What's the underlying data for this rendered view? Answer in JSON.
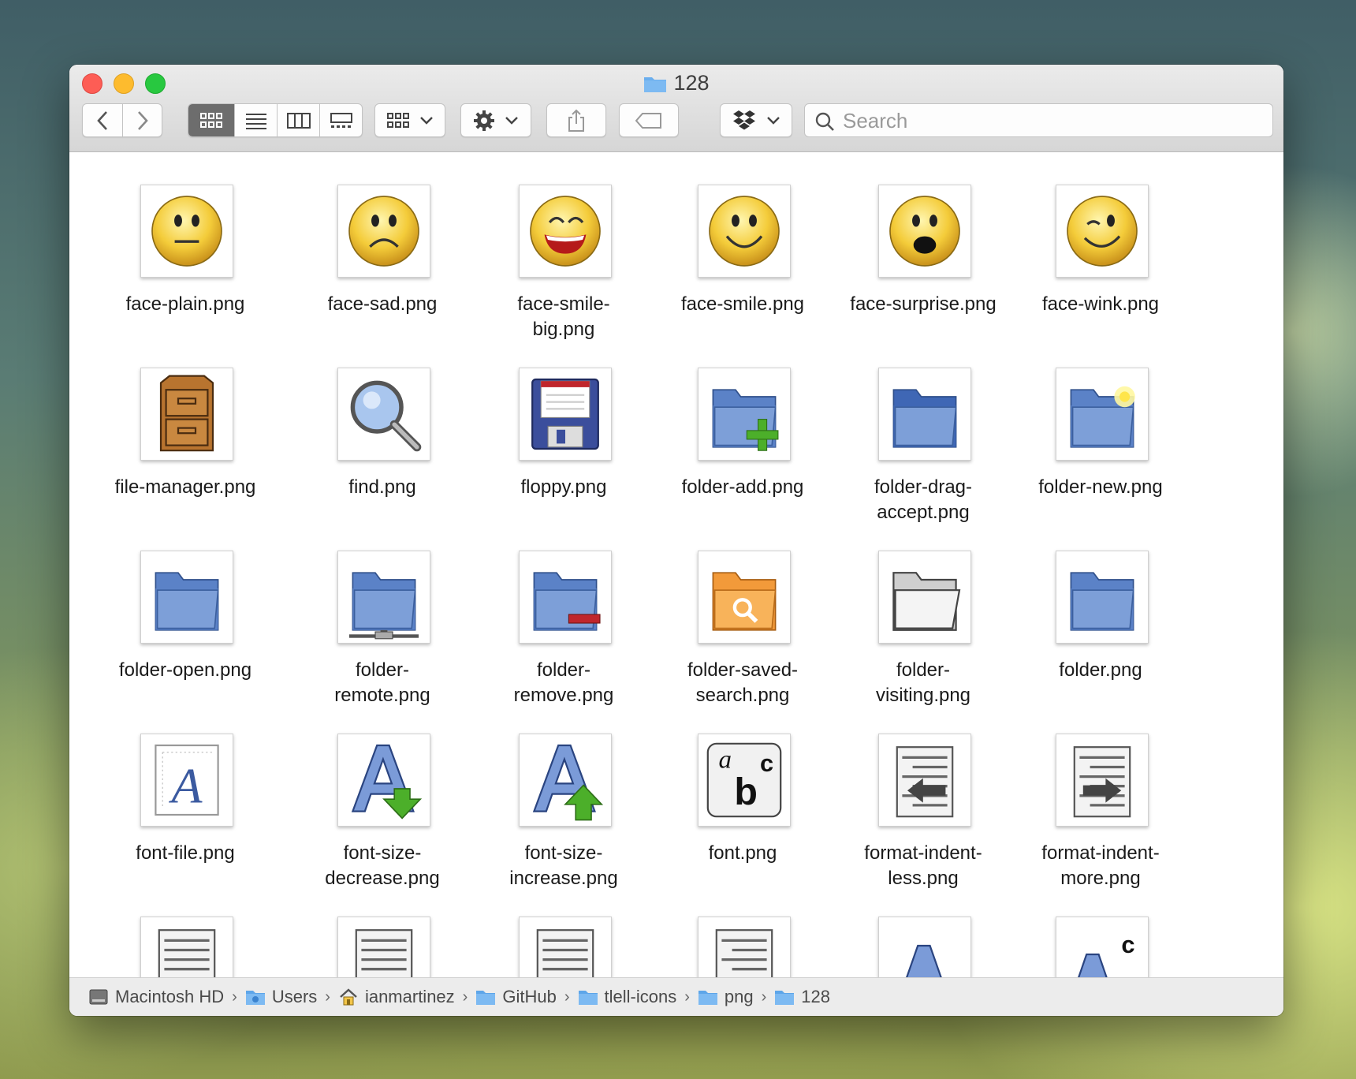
{
  "window": {
    "title": "128"
  },
  "toolbar": {
    "back_label": "back",
    "forward_label": "forward",
    "views": [
      "icon",
      "list",
      "column",
      "gallery"
    ],
    "arrange_label": "group",
    "action_label": "action",
    "share_label": "share",
    "tag_label": "tags",
    "dropbox_label": "dropbox"
  },
  "search": {
    "placeholder": "Search",
    "value": ""
  },
  "files": [
    {
      "name": "face-plain.png",
      "icon": "face-plain-icon"
    },
    {
      "name": "face-sad.png",
      "icon": "face-sad-icon"
    },
    {
      "name": "face-smile-big.png",
      "icon": "face-smile-big-icon"
    },
    {
      "name": "face-smile.png",
      "icon": "face-smile-icon"
    },
    {
      "name": "face-surprise.png",
      "icon": "face-surprise-icon"
    },
    {
      "name": "face-wink.png",
      "icon": "face-wink-icon"
    },
    {
      "name": "file-manager.png",
      "icon": "file-cabinet-icon"
    },
    {
      "name": "find.png",
      "icon": "magnifier-icon"
    },
    {
      "name": "floppy.png",
      "icon": "floppy-disk-icon"
    },
    {
      "name": "folder-add.png",
      "icon": "folder-add-icon"
    },
    {
      "name": "folder-drag-accept.png",
      "icon": "folder-drag-accept-icon"
    },
    {
      "name": "folder-new.png",
      "icon": "folder-new-icon"
    },
    {
      "name": "folder-open.png",
      "icon": "folder-open-icon"
    },
    {
      "name": "folder-remote.png",
      "icon": "folder-remote-icon"
    },
    {
      "name": "folder-remove.png",
      "icon": "folder-remove-icon"
    },
    {
      "name": "folder-saved-search.png",
      "icon": "folder-saved-search-icon"
    },
    {
      "name": "folder-visiting.png",
      "icon": "folder-visiting-icon"
    },
    {
      "name": "folder.png",
      "icon": "folder-icon"
    },
    {
      "name": "font-file.png",
      "icon": "font-file-icon"
    },
    {
      "name": "font-size-decrease.png",
      "icon": "font-size-decrease-icon"
    },
    {
      "name": "font-size-increase.png",
      "icon": "font-size-increase-icon"
    },
    {
      "name": "font.png",
      "icon": "font-icon"
    },
    {
      "name": "format-indent-less.png",
      "icon": "indent-less-icon"
    },
    {
      "name": "format-indent-more.png",
      "icon": "indent-more-icon"
    }
  ],
  "labels": [
    [
      "face-plain.png"
    ],
    [
      "face-sad.png"
    ],
    [
      "face-smile-",
      "big.png"
    ],
    [
      "face-smile.png"
    ],
    [
      "face-surprise.png"
    ],
    [
      "face-wink.png"
    ],
    [
      "file-manager.png"
    ],
    [
      "find.png"
    ],
    [
      "floppy.png"
    ],
    [
      "folder-add.png"
    ],
    [
      "folder-drag-",
      "accept.png"
    ],
    [
      "folder-new.png"
    ],
    [
      "folder-open.png"
    ],
    [
      "folder-",
      "remote.png"
    ],
    [
      "folder-",
      "remove.png"
    ],
    [
      "folder-saved-",
      "search.png"
    ],
    [
      "folder-",
      "visiting.png"
    ],
    [
      "folder.png"
    ],
    [
      "font-file.png"
    ],
    [
      "font-size-",
      "decrease.png"
    ],
    [
      "font-size-",
      "increase.png"
    ],
    [
      "font.png"
    ],
    [
      "format-indent-",
      "less.png"
    ],
    [
      "format-indent-",
      "more.png"
    ]
  ],
  "partial_row_icons": [
    "justify-icon",
    "justify-icon",
    "justify-icon",
    "justify-right-icon",
    "font-outline-icon",
    "font-superscript-icon"
  ],
  "breadcrumb": [
    {
      "label": "Macintosh HD",
      "icon": "hard-drive-icon"
    },
    {
      "label": "Users",
      "icon": "users-folder-icon"
    },
    {
      "label": "ianmartinez",
      "icon": "home-icon"
    },
    {
      "label": "GitHub",
      "icon": "folder-icon"
    },
    {
      "label": "tlell-icons",
      "icon": "folder-icon"
    },
    {
      "label": "png",
      "icon": "folder-icon"
    },
    {
      "label": "128",
      "icon": "folder-icon"
    }
  ],
  "colors": {
    "accent_folder": "#5ea6e9",
    "icon_folder": "#5b82c7",
    "smiley": "#f3c737"
  }
}
